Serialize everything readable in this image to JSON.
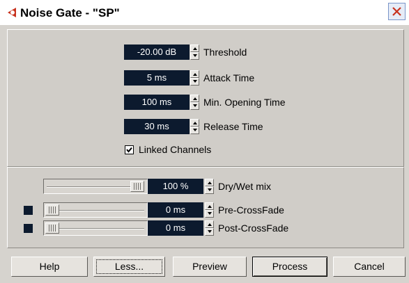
{
  "window": {
    "title": "Noise Gate - \"SP\"",
    "accent_color": "#c8321e",
    "close_icon": "close-icon"
  },
  "params": [
    {
      "value": "-20.00 dB",
      "label": "Threshold"
    },
    {
      "value": "5 ms",
      "label": "Attack Time"
    },
    {
      "value": "100 ms",
      "label": "Min. Opening Time"
    },
    {
      "value": "30 ms",
      "label": "Release Time"
    }
  ],
  "linked_channels": {
    "label": "Linked Channels",
    "checked": true
  },
  "mix": {
    "drywet": {
      "value": "100 %",
      "label": "Dry/Wet mix",
      "level_percent": 100
    },
    "precrossfade": {
      "value": "0 ms",
      "label": "Pre-CrossFade",
      "level_percent": 0
    },
    "postcrossfade": {
      "value": "0 ms",
      "label": "Post-CrossFade",
      "level_percent": 0
    }
  },
  "buttons": {
    "help": "Help",
    "less": "Less...",
    "preview": "Preview",
    "process": "Process",
    "cancel": "Cancel"
  },
  "colors": {
    "value_box": "#0c1a2e",
    "dialog_bg": "#d6d3ce"
  }
}
